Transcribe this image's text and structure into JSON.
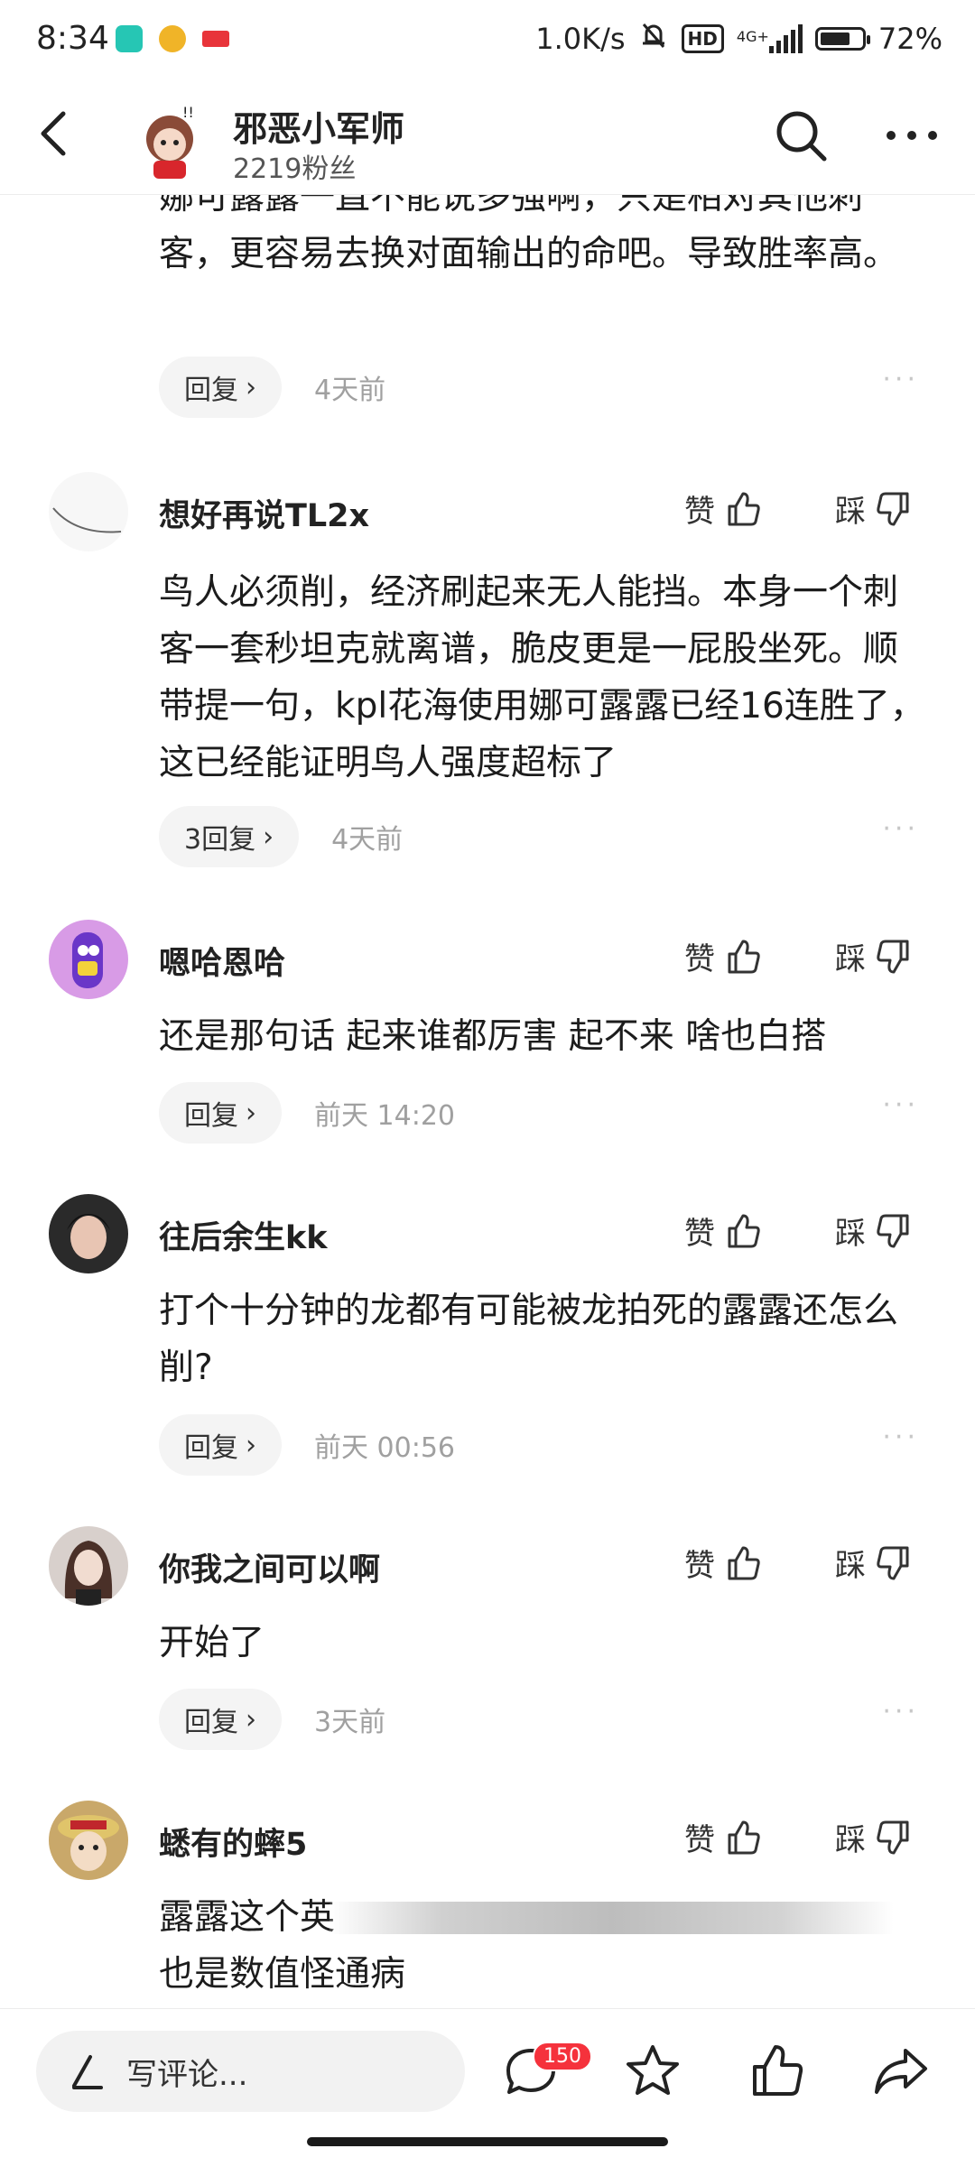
{
  "status_bar": {
    "time": "8:34",
    "net_speed": "1.0K/s",
    "hd": "HD",
    "network": "4G+",
    "battery_percent": 72,
    "battery_text": "72%"
  },
  "header": {
    "author_name": "邪恶小军师",
    "fans": "2219粉丝"
  },
  "comments": [
    {
      "partial": true,
      "text": "娜可露露一直不能说多强啊，只是相对其他刺客，更容易去换对面输出的命吧。导致胜率高。",
      "reply_label": "回复",
      "time": "4天前"
    },
    {
      "name": "想好再说TL2x",
      "like_label": "赞",
      "dislike_label": "踩",
      "text": "鸟人必须削，经济刷起来无人能挡。本身一个刺客一套秒坦克就离谱，脆皮更是一屁股坐死。顺带提一句，kpl花海使用娜可露露已经16连胜了，这已经能证明鸟人强度超标了",
      "reply_label": "3回复",
      "time": "4天前"
    },
    {
      "name": "嗯哈恩哈",
      "like_label": "赞",
      "dislike_label": "踩",
      "text": "还是那句话 起来谁都厉害 起不来 啥也白搭",
      "reply_label": "回复",
      "time": "前天  14:20"
    },
    {
      "name": "往后余生kk",
      "like_label": "赞",
      "dislike_label": "踩",
      "text": "打个十分钟的龙都有可能被龙拍死的露露还怎么削?",
      "reply_label": "回复",
      "time": "前天  00:56"
    },
    {
      "name": "你我之间可以啊",
      "like_label": "赞",
      "dislike_label": "踩",
      "text": "开始了",
      "reply_label": "回复",
      "time": "3天前"
    },
    {
      "name": "蟋有的蟀5",
      "like_label": "赞",
      "dislike_label": "踩",
      "text_line1": "露露这个英",
      "text_line2": "也是数值怪通病"
    }
  ],
  "bottom_bar": {
    "input_placeholder": "写评论...",
    "comment_count": "150"
  },
  "colors": {
    "badge_red": "#f5323c",
    "text_primary": "#1c1c1c",
    "text_secondary": "#a0a0a0"
  }
}
